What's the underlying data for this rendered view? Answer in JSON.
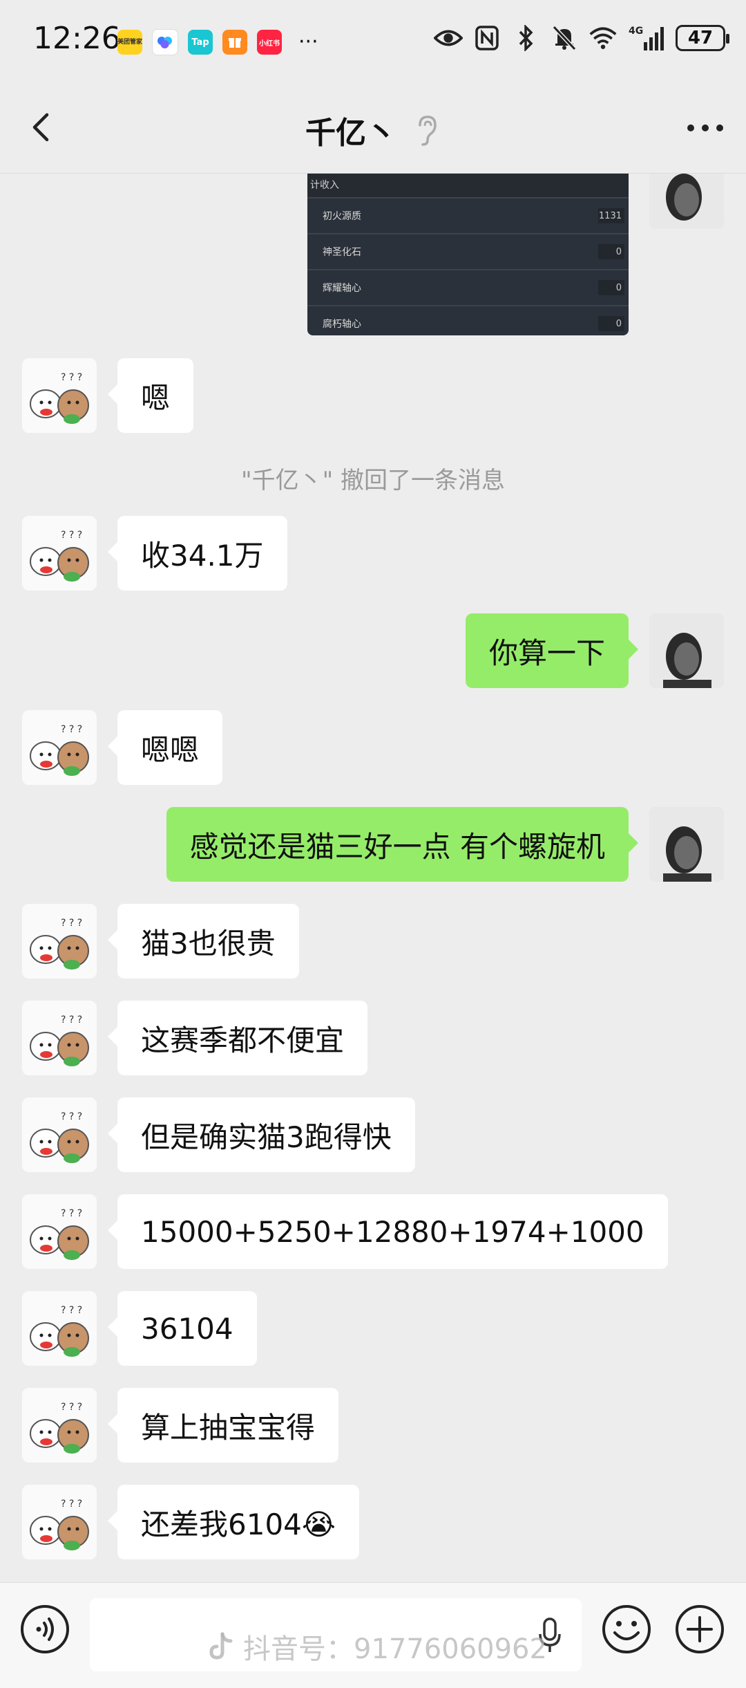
{
  "status_bar": {
    "time": "12:26",
    "apps": [
      {
        "name": "meituan-app-icon",
        "label": "美团管家",
        "color": "#ffd21f"
      },
      {
        "name": "cloud-app-icon",
        "label": "",
        "color": "#3a7bff"
      },
      {
        "name": "taptap-app-icon",
        "label": "Tap",
        "color": "#19c6d1"
      },
      {
        "name": "gift-app-icon",
        "label": "",
        "color": "#ff8a1f"
      },
      {
        "name": "xiaohongshu-app-icon",
        "label": "小红书",
        "color": "#ff2442"
      }
    ],
    "more": "···",
    "network": "4G",
    "battery": "47"
  },
  "header": {
    "title": "千亿丶"
  },
  "shared_image": {
    "header_label": "计收入",
    "rows": [
      {
        "label": "初火源质",
        "value": "1131"
      },
      {
        "label": "神圣化石",
        "value": "0"
      },
      {
        "label": "辉耀轴心",
        "value": "0"
      },
      {
        "label": "腐朽轴心",
        "value": "0"
      }
    ]
  },
  "messages": [
    {
      "side": "in",
      "text": "嗯"
    },
    {
      "side": "system",
      "text": "\"千亿丶\" 撤回了一条消息"
    },
    {
      "side": "in",
      "text": "收34.1万"
    },
    {
      "side": "out",
      "text": "你算一下"
    },
    {
      "side": "in",
      "text": "嗯嗯"
    },
    {
      "side": "out",
      "text": "感觉还是猫三好一点 有个螺旋机"
    },
    {
      "side": "in",
      "text": "猫3也很贵"
    },
    {
      "side": "in",
      "text": "这赛季都不便宜"
    },
    {
      "side": "in",
      "text": "但是确实猫3跑得快"
    },
    {
      "side": "in",
      "text": "15000+5250+12880+1974+1000"
    },
    {
      "side": "in",
      "text": "36104"
    },
    {
      "side": "in",
      "text": "算上抽宝宝得"
    },
    {
      "side": "in",
      "text": "还差我6104😭"
    }
  ],
  "input_bar": {
    "watermark": "抖音号：917760609​62"
  },
  "colors": {
    "background": "#ededed",
    "out_bubble": "#95ec69",
    "in_bubble": "#ffffff"
  }
}
